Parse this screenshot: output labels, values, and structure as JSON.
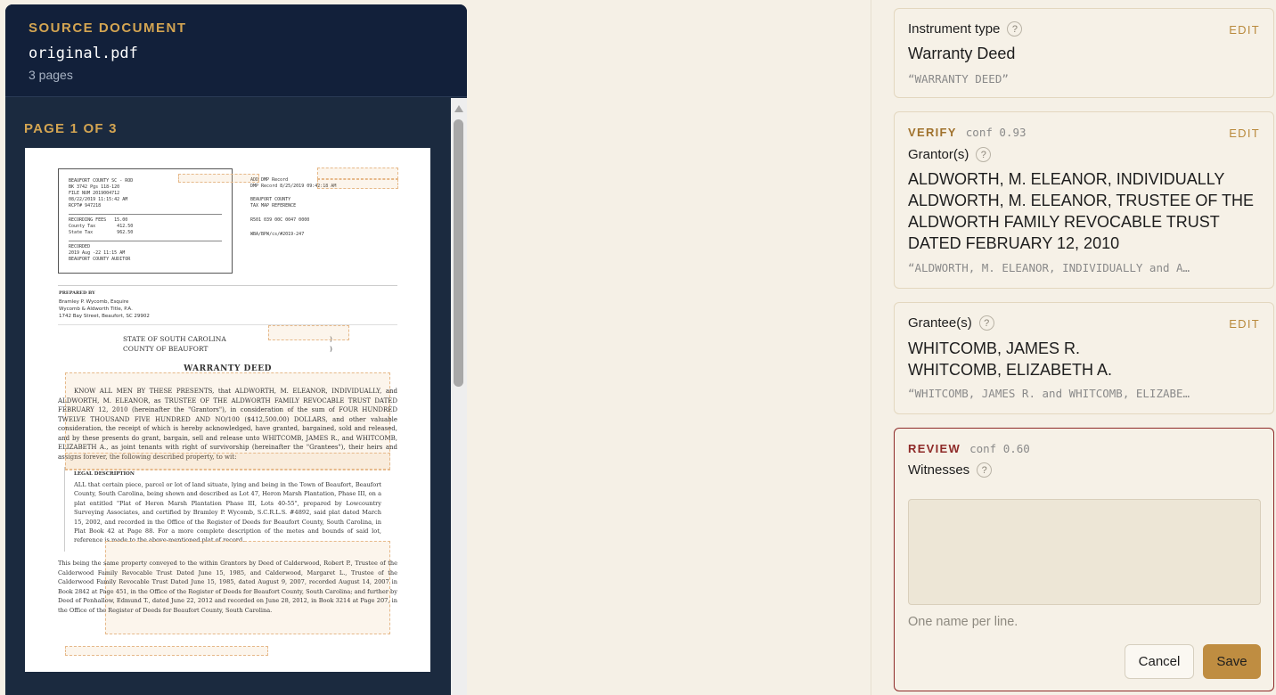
{
  "source": {
    "label": "SOURCE DOCUMENT",
    "filename": "original.pdf",
    "pages": "3 pages",
    "page_indicator": "PAGE 1 OF 3"
  },
  "document": {
    "stamp": [
      "BEAUFORT COUNTY SC - ROD",
      "BK 3742 Pgs 118-120",
      "FILE NUM 2019004712",
      "08/22/2019 11:15:42 AM",
      "RCPT# 947218",
      "RECORDING FEES   15.00",
      "County Tax        412.50",
      "State Tax         962.50",
      "RECORDED",
      "2019 Aug -22 11:15 AM",
      "BEAUFORT COUNTY AUDITOR"
    ],
    "side_refs": [
      "ADD DMP Record",
      "DMP Record 8/25/2019 09:42:18 AM",
      "BEAUFORT COUNTY",
      "TAX MAP REFERENCE",
      "R501 039 00C 0047 0000",
      "WBA/BPW/cs/#2019-247"
    ],
    "prepared_by_title": "PREPARED BY",
    "prepared_by": [
      "Bramley P. Wycomb, Esquire",
      "Wycomb & Aldworth Title, P.A.",
      "1742 Bay Street, Beaufort, SC 29902"
    ],
    "state": "STATE OF SOUTH CAROLINA",
    "county": "COUNTY OF BEAUFORT",
    "bracket": ")",
    "title": "WARRANTY DEED",
    "para1": "KNOW ALL MEN BY THESE PRESENTS, that ALDWORTH, M. ELEANOR, INDIVIDUALLY, and ALDWORTH, M. ELEANOR, as TRUSTEE OF THE ALDWORTH FAMILY REVOCABLE TRUST DATED FEBRUARY 12, 2010 (hereinafter the \"Grantors\"), in consideration of the sum of FOUR HUNDRED TWELVE THOUSAND FIVE HUNDRED AND NO/100 ($412,500.00) DOLLARS, and other valuable consideration, the receipt of which is hereby acknowledged, have granted, bargained, sold and released, and by these presents do grant, bargain, sell and release unto WHITCOMB, JAMES R., and WHITCOMB, ELIZABETH A., as joint tenants with right of survivorship (hereinafter the \"Grantees\"), their heirs and assigns forever, the following described property, to wit:",
    "legal_title": "LEGAL DESCRIPTION",
    "legal": "ALL that certain piece, parcel or lot of land situate, lying and being in the Town of Beaufort, Beaufort County, South Carolina, being shown and described as Lot 47, Heron Marsh Plantation, Phase III, on a plat entitled \"Plat of Heron Marsh Plantation Phase III, Lots 40-55\", prepared by Lowcountry Surveying Associates, and certified by Bramley P. Wycomb, S.C.R.L.S. #4892, said plat dated March 15, 2002, and recorded in the Office of the Register of Deeds for Beaufort County, South Carolina, in Plat Book 42 at Page 88. For a more complete description of the metes and bounds of said lot, reference is made to the above-mentioned plat of record.",
    "para2": "This being the same property conveyed to the within Grantors by Deed of Calderwood, Robert P., Trustee of the Calderwood Family Revocable Trust Dated June 15, 1985, and Calderwood, Margaret L., Trustee of the Calderwood Family Revocable Trust Dated June 15, 1985, dated August 9, 2007, recorded August 14, 2007 in Book 2842 at Page 451, in the Office of the Register of Deeds for Beaufort County, South Carolina; and further by Deed of Penhallow, Edmund T., dated June 22, 2012 and recorded on June 28, 2012, in Book 3214 at Page 207, in the Office of the Register of Deeds for Beaufort County, South Carolina."
  },
  "fields": {
    "instrument": {
      "label": "Instrument type",
      "help": "?",
      "edit": "EDIT",
      "value": "Warranty Deed",
      "raw": "“WARRANTY DEED”"
    },
    "grantor": {
      "status": "VERIFY",
      "conf": "conf 0.93",
      "label": "Grantor(s)",
      "help": "?",
      "edit": "EDIT",
      "values": [
        "ALDWORTH, M. ELEANOR, INDIVIDUALLY",
        "ALDWORTH, M. ELEANOR, TRUSTEE OF THE",
        "ALDWORTH FAMILY REVOCABLE TRUST",
        "DATED FEBRUARY 12, 2010"
      ],
      "raw": "“ALDWORTH, M. ELEANOR, INDIVIDUALLY and A…"
    },
    "grantee": {
      "label": "Grantee(s)",
      "help": "?",
      "edit": "EDIT",
      "values": [
        "WHITCOMB, JAMES R.",
        "WHITCOMB, ELIZABETH A."
      ],
      "raw": "“WHITCOMB, JAMES R. and WHITCOMB, ELIZABE…"
    },
    "witnesses": {
      "status": "REVIEW",
      "conf": "conf 0.60",
      "label": "Witnesses",
      "help": "?",
      "value": "",
      "hint": "One name per line.",
      "cancel": "Cancel",
      "save": "Save"
    }
  }
}
